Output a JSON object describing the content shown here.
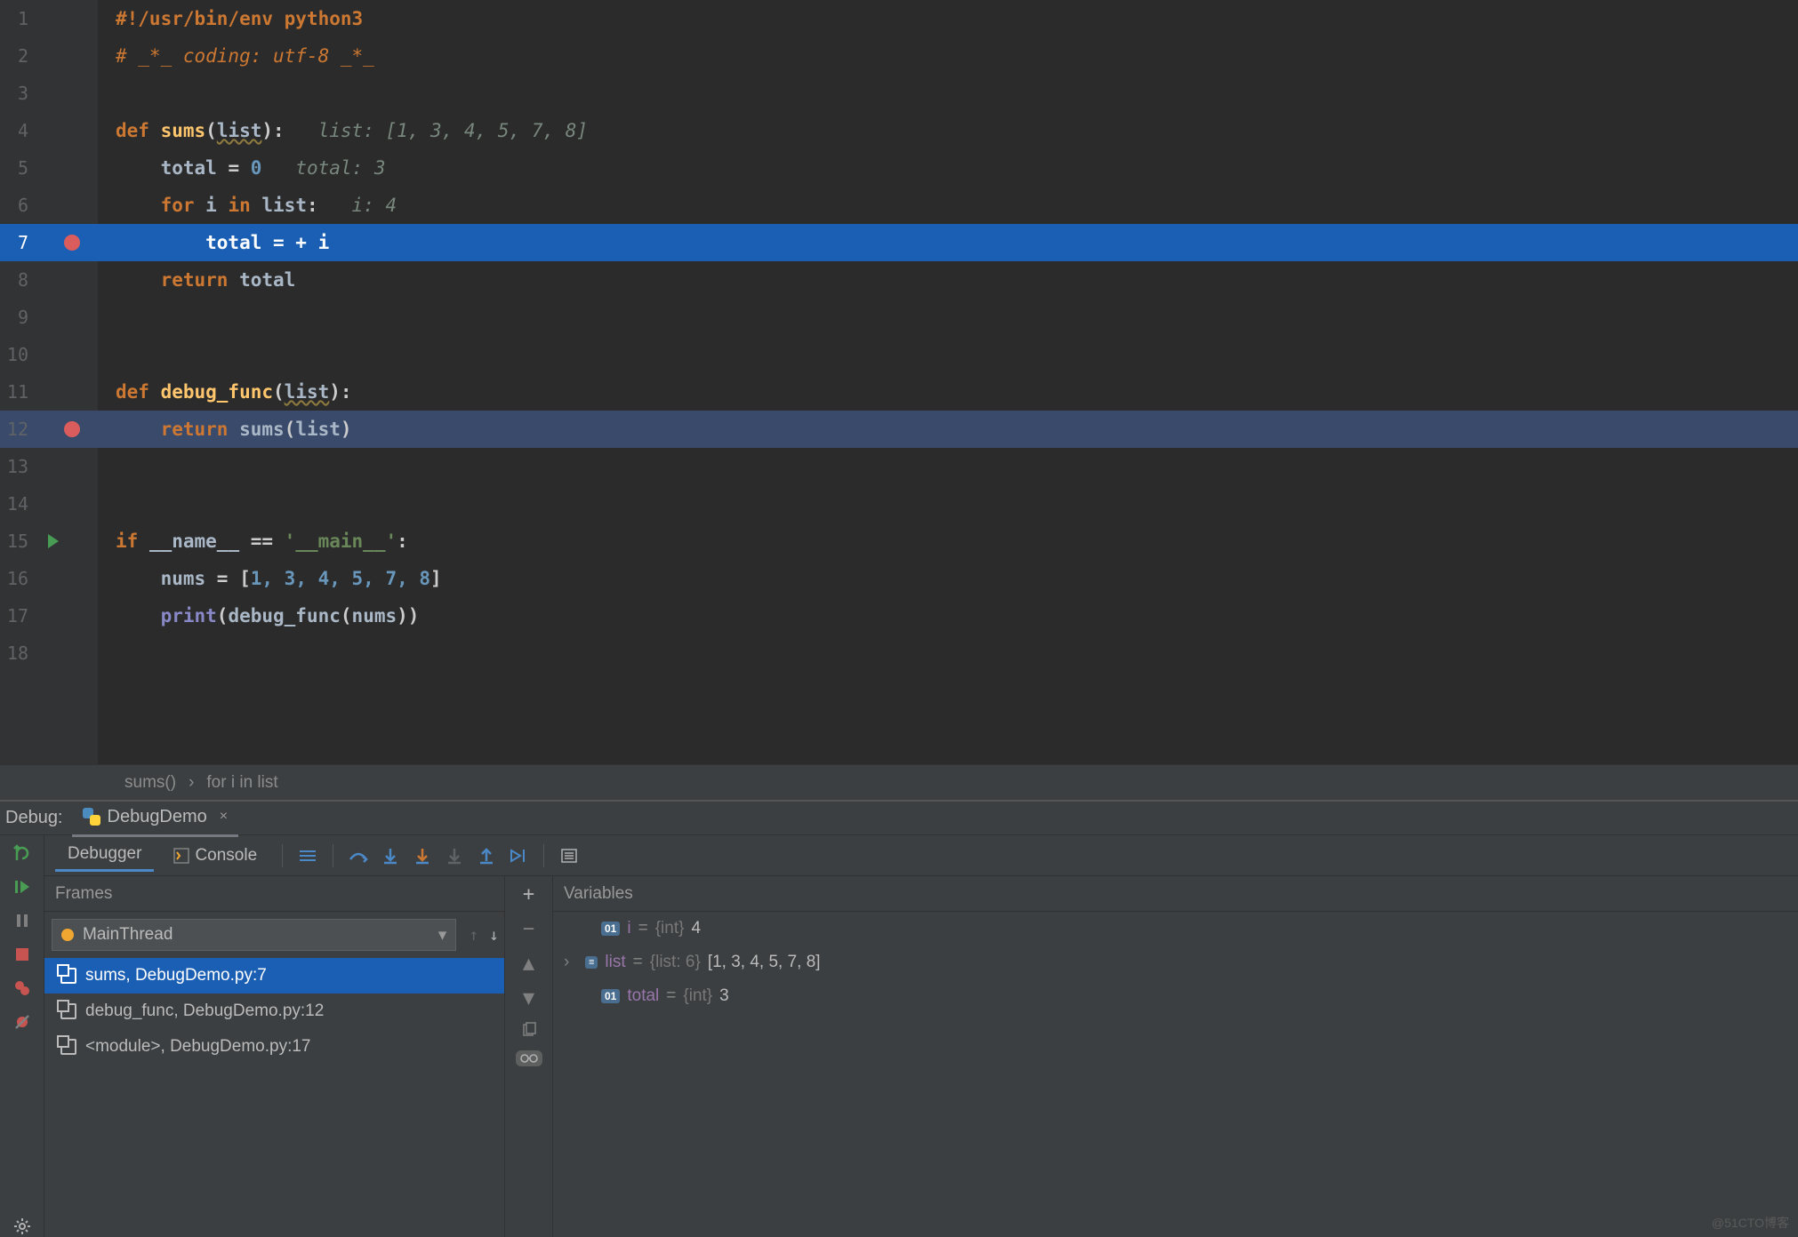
{
  "editor": {
    "lines": [
      {
        "n": 1
      },
      {
        "n": 2
      },
      {
        "n": 3
      },
      {
        "n": 4
      },
      {
        "n": 5
      },
      {
        "n": 6
      },
      {
        "n": 7,
        "bp": true,
        "exec": true
      },
      {
        "n": 8
      },
      {
        "n": 9
      },
      {
        "n": 10
      },
      {
        "n": 11
      },
      {
        "n": 12,
        "bp": true,
        "frame": true
      },
      {
        "n": 13
      },
      {
        "n": 14
      },
      {
        "n": 15,
        "run": true
      },
      {
        "n": 16
      },
      {
        "n": 17
      },
      {
        "n": 18
      }
    ]
  },
  "code": {
    "l1": "#!/usr/bin/env python3",
    "l2": "# _*_ coding: utf-8 _*_",
    "l4_def": "def ",
    "l4_fn": "sums",
    "l4_paren_o": "(",
    "l4_param": "list",
    "l4_paren_c": "):",
    "l4_inlay": "   list: [1, 3, 4, 5, 7, 8]",
    "l5_lhs": "    total ",
    "l5_eq": "= ",
    "l5_val": "0",
    "l5_inlay": "   total: 3",
    "l6_for": "    for ",
    "l6_var": "i ",
    "l6_in": "in ",
    "l6_it": "list",
    "l6_colon": ":",
    "l6_inlay": "   i: 4",
    "l7_lhs": "        total ",
    "l7_eq": "= + ",
    "l7_rhs": "i",
    "l8_ret": "    return ",
    "l8_val": "total",
    "l11_def": "def ",
    "l11_fn": "debug_func",
    "l11_po": "(",
    "l11_param": "list",
    "l11_pc": "):",
    "l12_ret": "    return ",
    "l12_fn": "sums",
    "l12_po": "(",
    "l12_arg": "list",
    "l12_pc": ")",
    "l15_if": "if ",
    "l15_name": "__name__ ",
    "l15_eq": "== ",
    "l15_str": "'__main__'",
    "l15_colon": ":",
    "l16_lhs": "    nums ",
    "l16_eq": "= ",
    "l16_bo": "[",
    "l16_vals": "1, 3, 4, 5, 7, 8",
    "l16_bc": "]",
    "l17_print": "    print",
    "l17_po": "(",
    "l17_fn": "debug_func",
    "l17_po2": "(",
    "l17_arg": "nums",
    "l17_pc": "))"
  },
  "breadcrumb": {
    "a": "sums()",
    "sep": "›",
    "b": "for i in list"
  },
  "debug": {
    "title": "Debug:",
    "config": "DebugDemo",
    "tabs": {
      "debugger": "Debugger",
      "console": "Console"
    },
    "frames_label": "Frames",
    "vars_label": "Variables",
    "thread": "MainThread",
    "frames": [
      {
        "label": "sums, DebugDemo.py:7",
        "sel": true
      },
      {
        "label": "debug_func, DebugDemo.py:12"
      },
      {
        "label": "<module>, DebugDemo.py:17"
      }
    ],
    "vars": [
      {
        "name": "i",
        "badge": "01",
        "type": "{int}",
        "val": "4"
      },
      {
        "name": "list",
        "badge": "≡",
        "type": "{list: 6}",
        "val": "[1, 3, 4, 5, 7, 8]",
        "expand": true
      },
      {
        "name": "total",
        "badge": "01",
        "type": "{int}",
        "val": "3"
      }
    ]
  },
  "watermark": "@51CTO博客"
}
